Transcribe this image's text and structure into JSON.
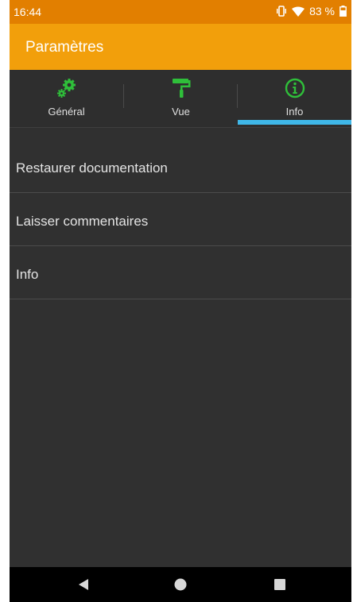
{
  "status_bar": {
    "time": "16:44",
    "battery_text": "83 %",
    "icons": [
      "vibrate-icon",
      "wifi-icon",
      "battery-icon"
    ]
  },
  "app_bar": {
    "title": "Paramètres",
    "color": "#f29f0b"
  },
  "tabs": [
    {
      "label": "Général",
      "icon": "gears-icon"
    },
    {
      "label": "Vue",
      "icon": "paint-roller-icon"
    },
    {
      "label": "Info",
      "icon": "info-circle-icon",
      "selected": true
    }
  ],
  "list": {
    "items": [
      {
        "label": "Restaurer documentation"
      },
      {
        "label": "Laisser commentaires"
      },
      {
        "label": "Info"
      }
    ]
  },
  "nav_bar": {
    "buttons": [
      "back-icon",
      "home-icon",
      "recents-icon"
    ]
  },
  "colors": {
    "accent_icon": "#2fbf3a",
    "tab_indicator": "#3fb7e8",
    "status_bar": "#e27f00"
  }
}
